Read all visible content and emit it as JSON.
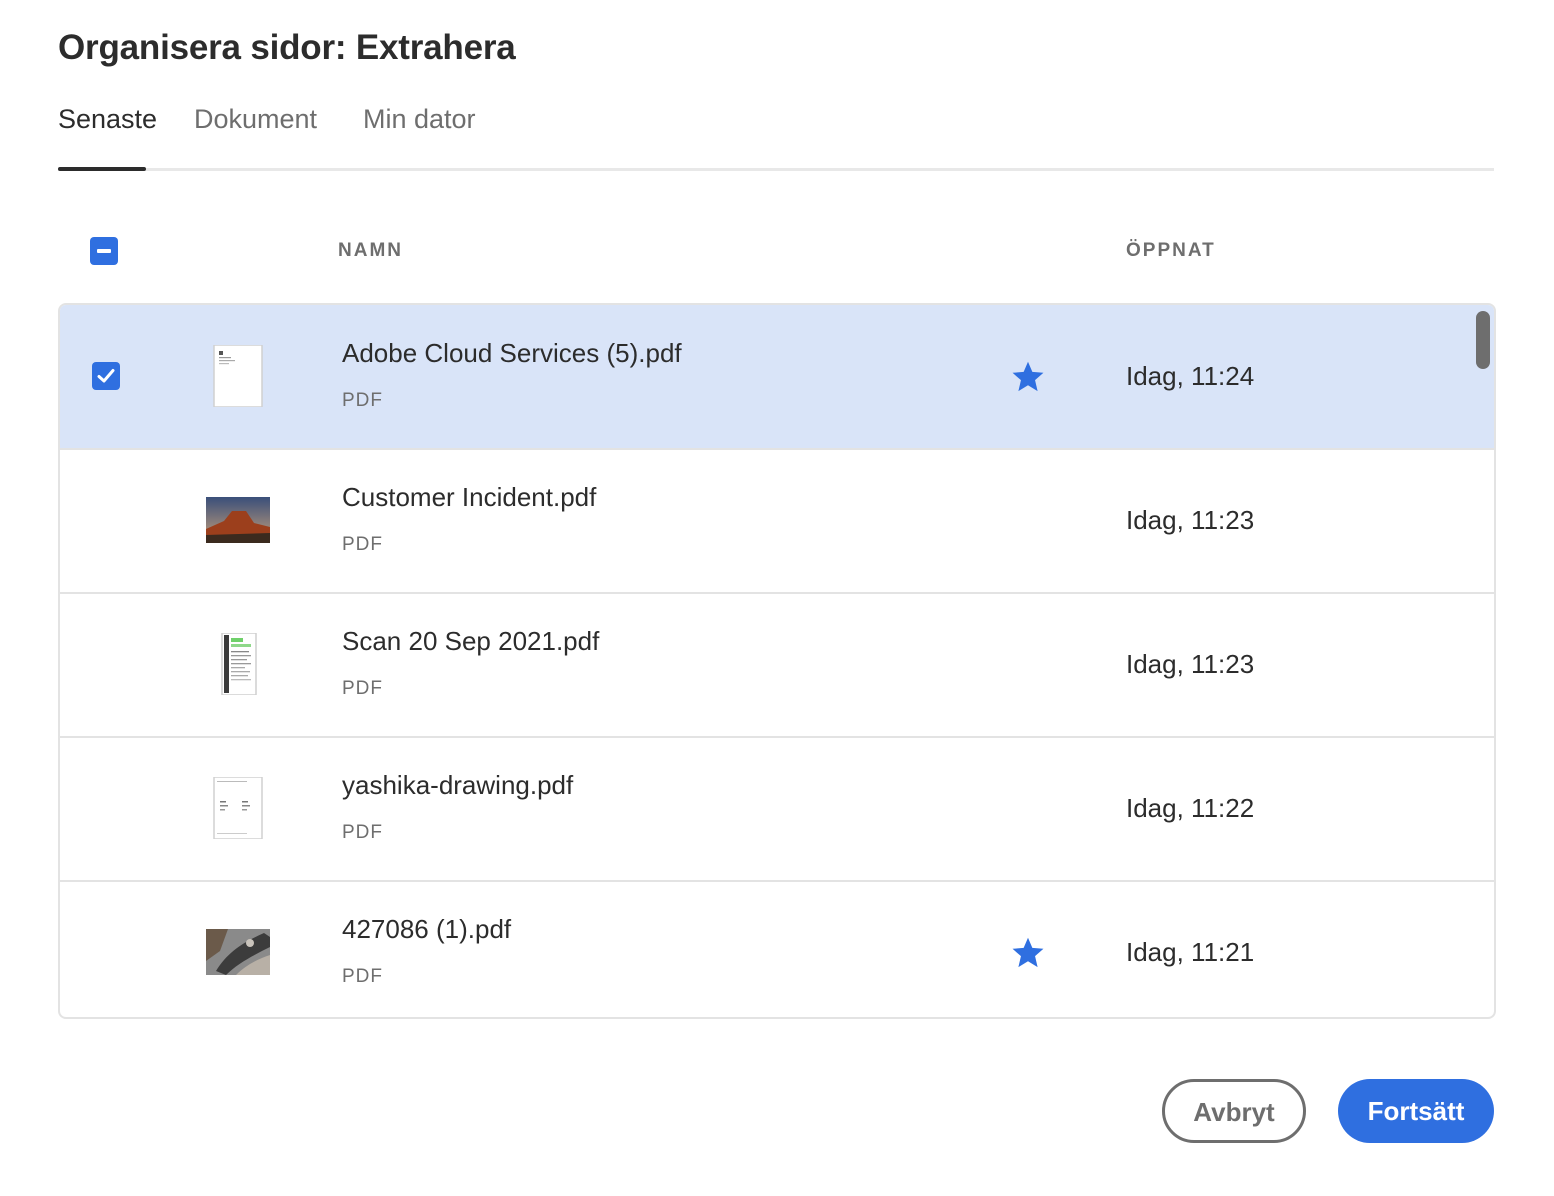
{
  "dialog": {
    "title": "Organisera sidor: Extrahera"
  },
  "tabs": [
    {
      "label": "Senaste",
      "active": true
    },
    {
      "label": "Dokument",
      "active": false
    },
    {
      "label": "Min dator",
      "active": false
    }
  ],
  "table": {
    "header": {
      "select_all_state": "indeterminate",
      "name_label": "NAMN",
      "opened_label": "ÖPPNAT"
    },
    "rows": [
      {
        "name": "Adobe Cloud Services (5).pdf",
        "type": "PDF",
        "opened": "Idag, 11:24",
        "starred": true,
        "selected": true,
        "thumbnail": "document-page"
      },
      {
        "name": "Customer Incident.pdf",
        "type": "PDF",
        "opened": "Idag, 11:23",
        "starred": false,
        "selected": false,
        "thumbnail": "landscape-photo"
      },
      {
        "name": "Scan 20 Sep 2021.pdf",
        "type": "PDF",
        "opened": "Idag, 11:23",
        "starred": false,
        "selected": false,
        "thumbnail": "scanned-page"
      },
      {
        "name": "yashika-drawing.pdf",
        "type": "PDF",
        "opened": "Idag, 11:22",
        "starred": false,
        "selected": false,
        "thumbnail": "drawing-page"
      },
      {
        "name": "427086 (1).pdf",
        "type": "PDF",
        "opened": "Idag, 11:21",
        "starred": true,
        "selected": false,
        "thumbnail": "photo"
      }
    ]
  },
  "footer": {
    "cancel_label": "Avbryt",
    "continue_label": "Fortsätt"
  },
  "colors": {
    "accent": "#2f6fe0",
    "selected_row": "#d9e4f8",
    "text_primary": "#2c2c2c",
    "text_secondary": "#6e6e6e"
  }
}
